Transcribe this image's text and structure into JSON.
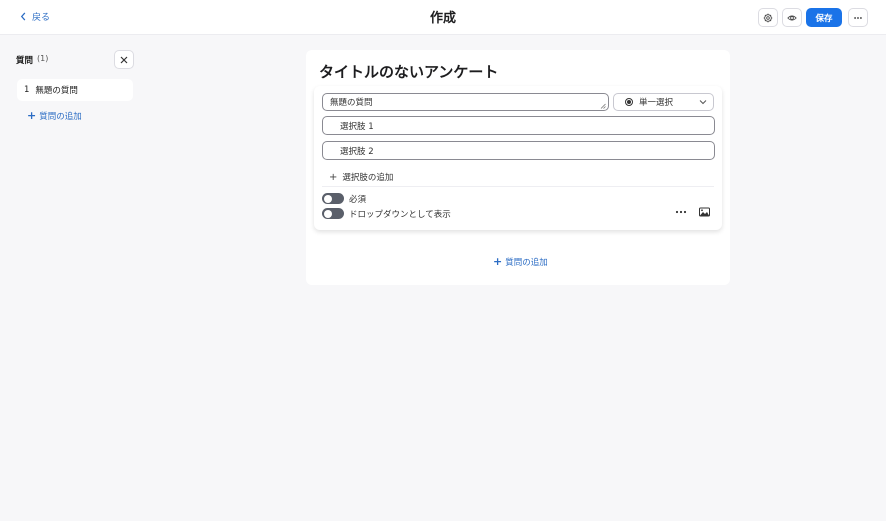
{
  "header": {
    "back_label": "戻る",
    "title": "作成",
    "save_label": "保存"
  },
  "sidebar": {
    "title": "質問",
    "count": "(1)",
    "items": [
      {
        "number": "1",
        "label": "無題の質問"
      }
    ],
    "add_label": "質問の追加"
  },
  "survey": {
    "title": "タイトルのないアンケート",
    "question": {
      "placeholder": "無題の質問",
      "type_label": "単一選択",
      "options": [
        "選択肢 1",
        "選択肢 2"
      ],
      "add_option_label": "選択肢の追加",
      "required_label": "必須",
      "dropdown_label": "ドロップダウンとして表示",
      "required_on": false,
      "dropdown_on": false
    },
    "add_question_label": "質問の追加"
  },
  "colors": {
    "accent": "#1a73e8",
    "link": "#2b6cc4",
    "toggle_off": "#5a5f6a"
  },
  "icons": [
    "chevron-left-icon",
    "settings-icon",
    "eye-icon",
    "more-icon",
    "close-icon",
    "plus-icon",
    "radio-icon",
    "chevron-down-icon",
    "image-icon"
  ]
}
